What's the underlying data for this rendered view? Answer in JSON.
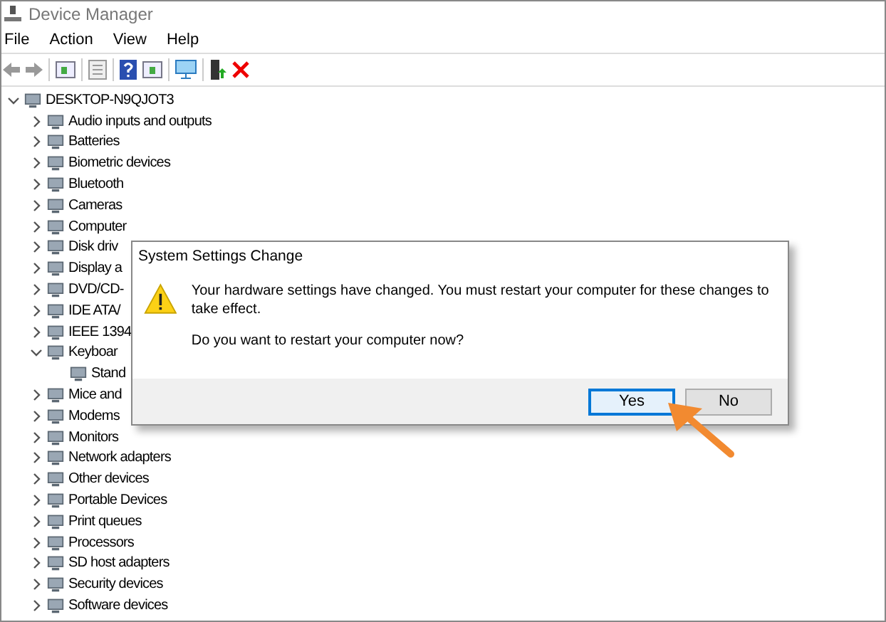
{
  "window": {
    "title": "Device Manager"
  },
  "menu": [
    "File",
    "Action",
    "View",
    "Help"
  ],
  "tree": {
    "label": "DESKTOP-N9QJOT3",
    "expanded": true,
    "children": [
      {
        "label": "Audio inputs and outputs",
        "expanded": false
      },
      {
        "label": "Batteries",
        "expanded": false
      },
      {
        "label": "Biometric devices",
        "expanded": false
      },
      {
        "label": "Bluetooth",
        "expanded": false
      },
      {
        "label": "Cameras",
        "expanded": false
      },
      {
        "label": "Computer",
        "expanded": false
      },
      {
        "label": "Disk driv",
        "expanded": false
      },
      {
        "label": "Display a",
        "expanded": false
      },
      {
        "label": "DVD/CD-",
        "expanded": false
      },
      {
        "label": "IDE ATA/",
        "expanded": false
      },
      {
        "label": "IEEE 1394",
        "expanded": false
      },
      {
        "label": "Keyboar",
        "expanded": true,
        "children": [
          {
            "label": "Stand"
          }
        ]
      },
      {
        "label": "Mice and",
        "expanded": false
      },
      {
        "label": "Modems",
        "expanded": false
      },
      {
        "label": "Monitors",
        "expanded": false
      },
      {
        "label": "Network adapters",
        "expanded": false
      },
      {
        "label": "Other devices",
        "expanded": false
      },
      {
        "label": "Portable Devices",
        "expanded": false
      },
      {
        "label": "Print queues",
        "expanded": false
      },
      {
        "label": "Processors",
        "expanded": false
      },
      {
        "label": "SD host adapters",
        "expanded": false
      },
      {
        "label": "Security devices",
        "expanded": false
      },
      {
        "label": "Software devices",
        "expanded": false
      }
    ]
  },
  "dialog": {
    "title": "System Settings Change",
    "message": "Your hardware settings have changed. You must restart your computer for these changes to take effect.",
    "question": "Do you want to restart your computer now?",
    "buttons": [
      {
        "label": "Yes",
        "selected": true
      },
      {
        "label": "No",
        "selected": false
      }
    ]
  }
}
